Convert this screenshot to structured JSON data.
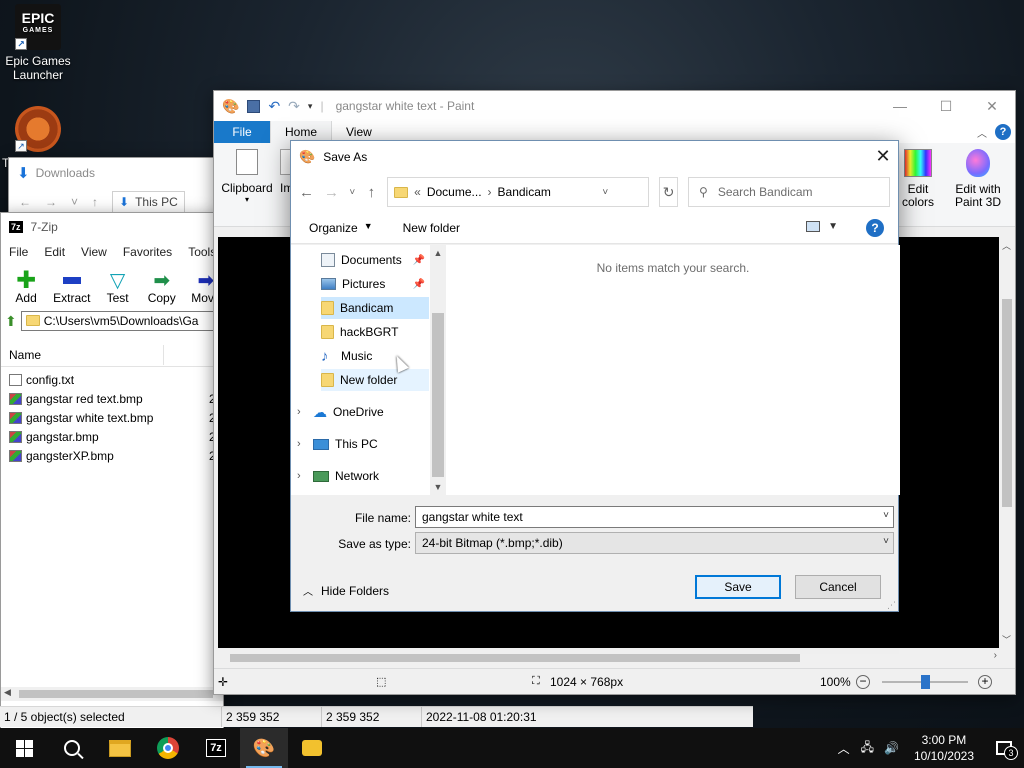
{
  "desktop": {
    "icons": [
      {
        "label": "Epic Games Launcher",
        "tile_text": "EPIC",
        "tile_sub": "GAMES"
      },
      {
        "label": "T"
      }
    ]
  },
  "explorer": {
    "title": "Downloads",
    "address": "This PC"
  },
  "zip": {
    "app_title": "7-Zip",
    "logo": "7z",
    "menu": [
      "File",
      "Edit",
      "View",
      "Favorites",
      "Tools"
    ],
    "toolbar": [
      "Add",
      "Extract",
      "Test",
      "Copy",
      "Move"
    ],
    "path": "C:\\Users\\vm5\\Downloads\\Ga",
    "column_name": "Name",
    "files": [
      {
        "name": "config.txt",
        "type": "txt",
        "size": ""
      },
      {
        "name": "gangstar red text.bmp",
        "type": "bmp",
        "size": "2"
      },
      {
        "name": "gangstar white text.bmp",
        "type": "bmp",
        "size": "2"
      },
      {
        "name": "gangstar.bmp",
        "type": "bmp",
        "size": "2"
      },
      {
        "name": "gangsterXP.bmp",
        "type": "bmp",
        "size": "2"
      }
    ],
    "status": [
      "1 / 5 object(s) selected",
      "2 359 352",
      "2 359 352",
      "2022-11-08 01:20:31"
    ]
  },
  "paint": {
    "title": "gangstar white text - Paint",
    "tabs": [
      "File",
      "Home",
      "View"
    ],
    "ribbon": {
      "clipboard": "Clipboard",
      "im": "Im",
      "edit_colors": "Edit colors",
      "edit_paint3d": "Edit with Paint 3D"
    },
    "status": {
      "size": "1024 × 768px",
      "zoom": "100%",
      "zoom_level": 0.5
    }
  },
  "save_as": {
    "title": "Save As",
    "breadcrumb": [
      "Docume...",
      "Bandicam"
    ],
    "search_placeholder": "Search Bandicam",
    "cmd": {
      "organize": "Organize",
      "new_folder": "New folder",
      "help": "?"
    },
    "tree": {
      "quick": [
        "Documents",
        "Pictures",
        "Bandicam",
        "hackBGRT",
        "Music",
        "New folder"
      ],
      "roots": [
        "OneDrive",
        "This PC",
        "Network"
      ]
    },
    "empty_message": "No items match your search.",
    "file_name_label": "File name:",
    "file_name": "gangstar white text",
    "save_type_label": "Save as type:",
    "save_type": "24-bit Bitmap (*.bmp;*.dib)",
    "hide_folders": "Hide Folders",
    "save": "Save",
    "cancel": "Cancel"
  },
  "taskbar": {
    "time": "3:00 PM",
    "date": "10/10/2023",
    "notifications": "3"
  }
}
